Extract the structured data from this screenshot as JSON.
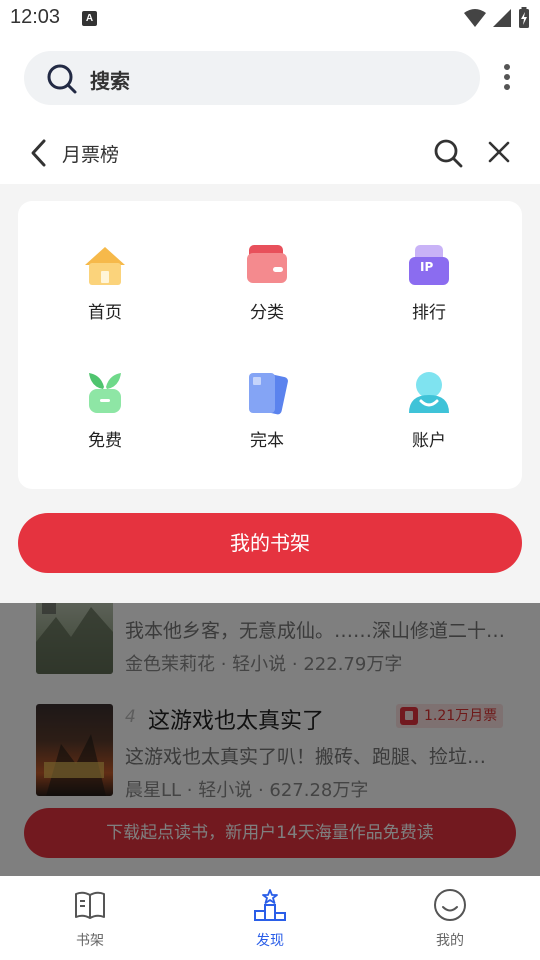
{
  "status": {
    "time": "12:03",
    "notification_letter": "A"
  },
  "search": {
    "placeholder_label": "搜索"
  },
  "header": {
    "title": "月票榜"
  },
  "menu": {
    "items": [
      {
        "label": "首页",
        "icon": "home-house-icon"
      },
      {
        "label": "分类",
        "icon": "category-wallet-icon"
      },
      {
        "label": "排行",
        "icon": "ranking-ip-icon"
      },
      {
        "label": "免费",
        "icon": "free-sprout-icon"
      },
      {
        "label": "完本",
        "icon": "finished-books-icon"
      },
      {
        "label": "账户",
        "icon": "account-person-icon"
      }
    ],
    "shelf_button": "我的书架"
  },
  "books": [
    {
      "desc": "我本他乡客，无意成仙。……深山修道二十…",
      "author": "金色茉莉花",
      "category": "轻小说",
      "words": "222.79万字"
    },
    {
      "rank": "4",
      "title": "这游戏也太真实了",
      "badge": "1.21万月票",
      "desc": "这游戏也太真实了叭！搬砖、跑腿、捡垃…",
      "author": "晨星LL",
      "category": "轻小说",
      "words": "627.28万字"
    }
  ],
  "promo": {
    "text": "下载起点读书，新用户14天海量作品免费读"
  },
  "bottom_nav": [
    {
      "label": "书架",
      "icon": "bookshelf-icon",
      "active": false
    },
    {
      "label": "发现",
      "icon": "discover-podium-icon",
      "active": true
    },
    {
      "label": "我的",
      "icon": "profile-smile-icon",
      "active": false
    }
  ],
  "colors": {
    "accent_red": "#e5333f",
    "active_blue": "#2a5ee8"
  }
}
